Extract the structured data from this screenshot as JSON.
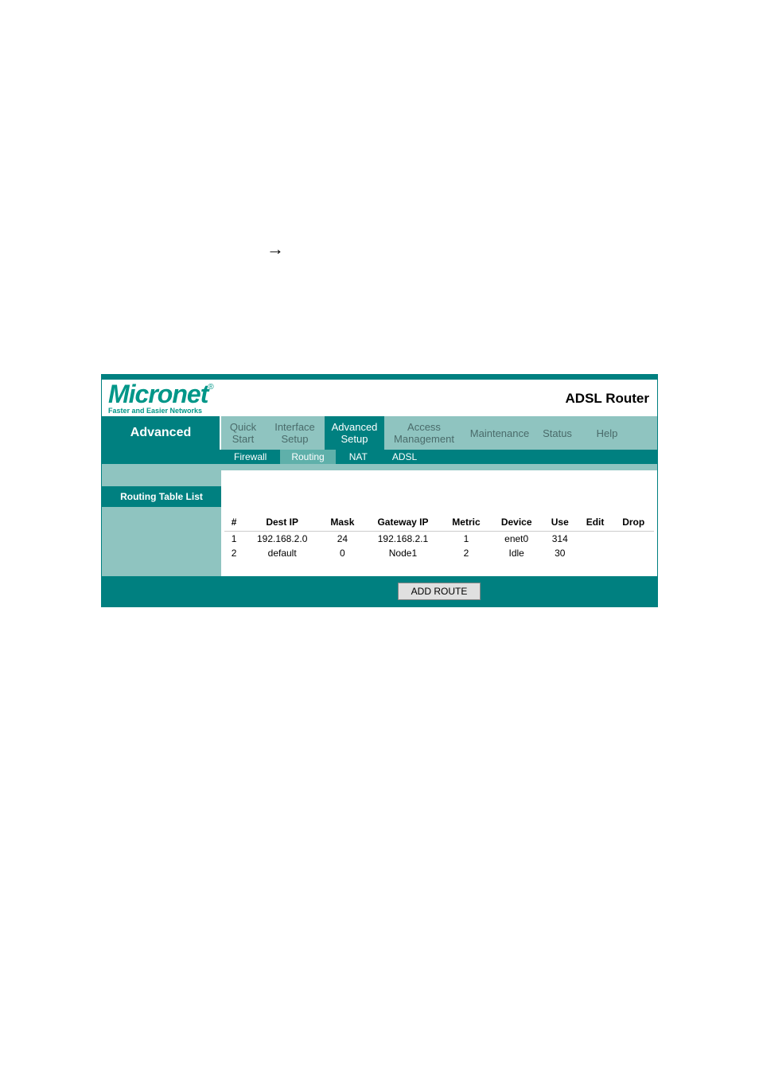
{
  "arrow": "→",
  "logo": {
    "brand": "Micronet",
    "mark": "®",
    "tagline": "Faster and Easier Networks"
  },
  "product_name": "ADSL Router",
  "nav": {
    "current_label": "Advanced",
    "items": [
      {
        "label": "Quick\nStart"
      },
      {
        "label": "Interface\nSetup"
      },
      {
        "label": "Advanced\nSetup"
      },
      {
        "label": "Access\nManagement"
      },
      {
        "label": "Maintenance"
      },
      {
        "label": "Status"
      },
      {
        "label": "Help"
      }
    ]
  },
  "subnav": {
    "items": [
      {
        "label": "Firewall"
      },
      {
        "label": "Routing"
      },
      {
        "label": "NAT"
      },
      {
        "label": "ADSL"
      }
    ]
  },
  "section_title": "Routing Table List",
  "table": {
    "headers": [
      "#",
      "Dest IP",
      "Mask",
      "Gateway IP",
      "Metric",
      "Device",
      "Use",
      "Edit",
      "Drop"
    ],
    "rows": [
      {
        "num": "1",
        "dest_ip": "192.168.2.0",
        "mask": "24",
        "gateway_ip": "192.168.2.1",
        "metric": "1",
        "device": "enet0",
        "use": "314",
        "edit": "",
        "drop": ""
      },
      {
        "num": "2",
        "dest_ip": "default",
        "mask": "0",
        "gateway_ip": "Node1",
        "metric": "2",
        "device": "Idle",
        "use": "30",
        "edit": "",
        "drop": ""
      }
    ]
  },
  "buttons": {
    "add_route": "ADD ROUTE"
  }
}
